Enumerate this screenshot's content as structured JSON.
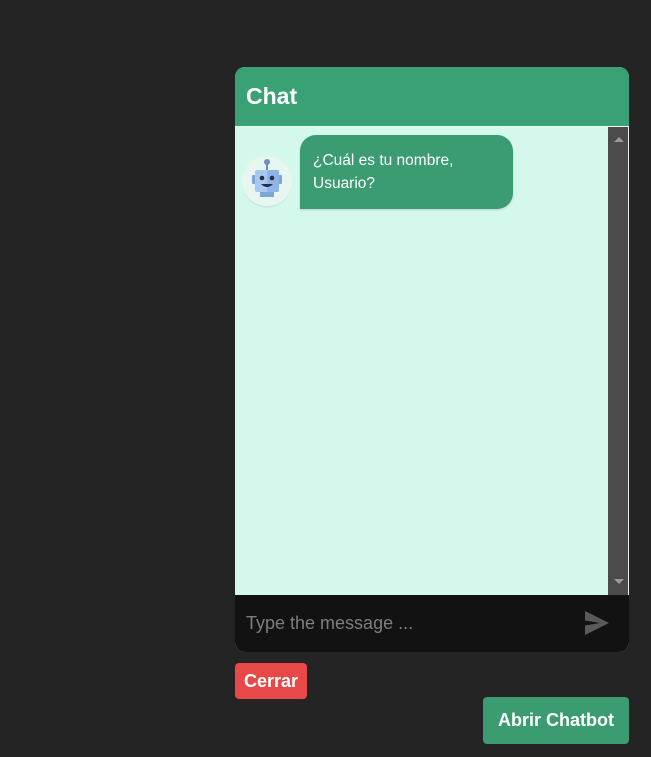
{
  "chat": {
    "title": "Chat",
    "messages": [
      {
        "sender": "bot",
        "avatar_icon": "robot-icon",
        "text": "¿Cuál es tu nombre, Usuario?"
      }
    ],
    "input": {
      "value": "",
      "placeholder": "Type the message ..."
    },
    "send_icon": "send-icon"
  },
  "buttons": {
    "close_label": "Cerrar",
    "open_label": "Abrir Chatbot"
  },
  "colors": {
    "page_background": "#242424",
    "header_accent": "#3aa174",
    "chat_background": "#d5f8ec",
    "bot_bubble": "#3a9c70",
    "close_button": "#e84848",
    "open_button": "#3a9c70",
    "input_bar": "#121212"
  }
}
